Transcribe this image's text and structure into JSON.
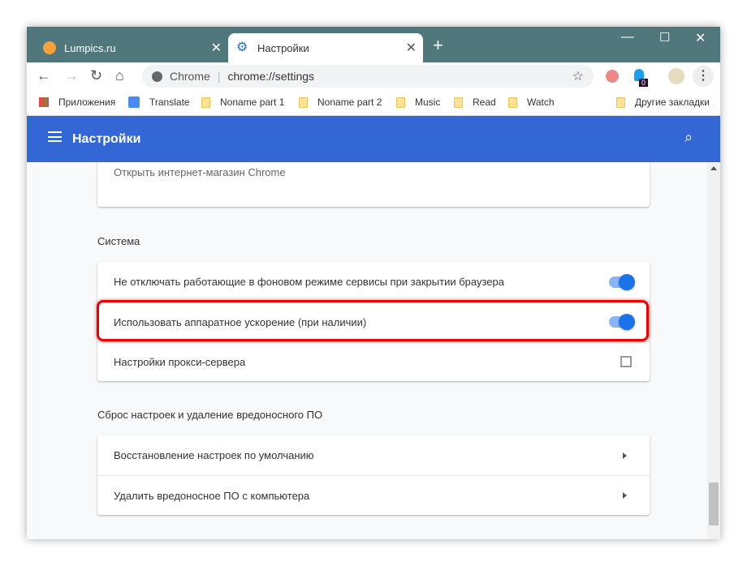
{
  "tabs": [
    {
      "title": "Lumpics.ru",
      "icon": "orange-icon"
    },
    {
      "title": "Настройки",
      "icon": "gear-icon",
      "active": true
    }
  ],
  "omnibox": {
    "site": "Chrome",
    "url": "chrome://settings"
  },
  "extensions": {
    "badge": "0"
  },
  "bookmarks": [
    {
      "label": "Приложения",
      "icon": "apps-icon"
    },
    {
      "label": "Translate",
      "icon": "translate-icon"
    },
    {
      "label": "Noname part 1"
    },
    {
      "label": "Noname part 2"
    },
    {
      "label": "Music"
    },
    {
      "label": "Read"
    },
    {
      "label": "Watch"
    }
  ],
  "other_bookmarks": "Другие закладки",
  "header": {
    "title": "Настройки"
  },
  "content": {
    "partial_row": "Открыть интернет-магазин Chrome",
    "system": {
      "title": "Система",
      "rows": [
        {
          "label": "Не отключать работающие в фоновом режиме сервисы при закрытии браузера",
          "toggle": true
        },
        {
          "label": "Использовать аппаратное ускорение (при наличии)",
          "toggle": true,
          "highlighted": true
        },
        {
          "label": "Настройки прокси-сервера",
          "icon": "open-in-new-icon"
        }
      ]
    },
    "reset": {
      "title": "Сброс настроек и удаление вредоносного ПО",
      "rows": [
        {
          "label": "Восстановление настроек по умолчанию"
        },
        {
          "label": "Удалить вредоносное ПО с компьютера"
        }
      ]
    }
  },
  "colors": {
    "tabbar": "#50777b",
    "header": "#3367d6",
    "toggle": "#1a73e8",
    "highlight": "#ee0000"
  }
}
